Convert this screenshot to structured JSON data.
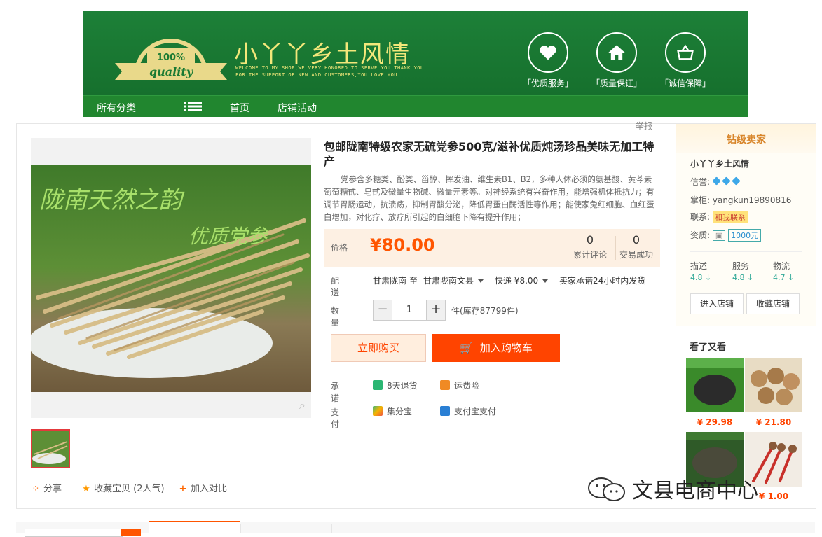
{
  "banner": {
    "badge_top": "100%",
    "badge_text": "quality",
    "shop_name": "小丫丫乡土风情",
    "slogan_line1": "WELCOME TO MY SHOP,WE VERY HONORED TO SERVE YOU,THANK YOU",
    "slogan_line2": "FOR THE SUPPORT OF NEW AND CUSTOMERS,YOU LOVE YOU",
    "services": [
      "「优质服务」",
      "「质量保证」",
      "「诚信保障」"
    ],
    "nav": {
      "all_categories": "所有分类",
      "home": "首页",
      "activities": "店铺活动"
    }
  },
  "report_label": "举报",
  "product": {
    "photo_text1": "陇南天然之韵",
    "photo_text2": "优质党参",
    "title": "包邮陇南特级农家无硫党参500克/滋补优质炖汤珍品美味无加工特产",
    "description": "党参含多糖类、酚类、甾醇、挥发油、维生素B1、B2，多种人体必须的氨基酸、黄芩素葡萄糖甙、皂甙及微量生物碱、微量元素等。对神经系统有兴奋作用，能增强机体抵抗力；有调节胃肠运动，抗溃疡，抑制胃酸分泌，降低胃蛋白酶活性等作用；能使家兔红细胞、血红蛋白增加，对化疗、放疗所引起的白细胞下降有提升作用；",
    "price_label": "价格",
    "price": "¥80.00",
    "reviews_count": "0",
    "reviews_label": "累计评论",
    "deals_count": "0",
    "deals_label": "交易成功",
    "shipping_label": "配送",
    "shipping_from": "甘肃陇南",
    "shipping_to_word": "至",
    "shipping_to": "甘肃陇南文县",
    "shipping_fee": "快递 ¥8.00",
    "shipping_promise": "卖家承诺24小时内发货",
    "quantity_label": "数量",
    "quantity": "1",
    "minus": "−",
    "plus": "+",
    "stock": "件(库存87799件)",
    "buy_now": "立即购买",
    "add_to_cart": "加入购物车",
    "promise_label": "承诺",
    "promise_1": "8天退货",
    "promise_2": "运费险",
    "pay_label": "支付",
    "pay_1": "集分宝",
    "pay_2": "支付宝支付"
  },
  "share": {
    "share": "分享",
    "favorite": "收藏宝贝 (2人气)",
    "compare": "加入对比"
  },
  "seller": {
    "level": "钻级卖家",
    "name": "小丫丫乡土风情",
    "credit_label": "信誉:",
    "keeper_label": "掌柜:",
    "keeper": "yangkun19890816",
    "contact_label": "联系:",
    "contact_btn": "和我联系",
    "qual_label": "资质:",
    "deposit": "1000元",
    "ratings": [
      {
        "label": "描述",
        "value": "4.8"
      },
      {
        "label": "服务",
        "value": "4.8"
      },
      {
        "label": "物流",
        "value": "4.7"
      }
    ],
    "enter_shop": "进入店铺",
    "fav_shop": "收藏店铺"
  },
  "also_viewed": {
    "title": "看了又看",
    "items": [
      {
        "price": "¥ 29.98"
      },
      {
        "price": "¥ 21.80"
      },
      {
        "price": ""
      },
      {
        "price": "¥ 1.00"
      }
    ]
  },
  "watermark": "文县电商中心",
  "colors": {
    "banner_green": "#1a7a33",
    "price_orange": "#ff5500",
    "cart_btn": "#ff4400",
    "seller_gold": "#d8852a"
  }
}
